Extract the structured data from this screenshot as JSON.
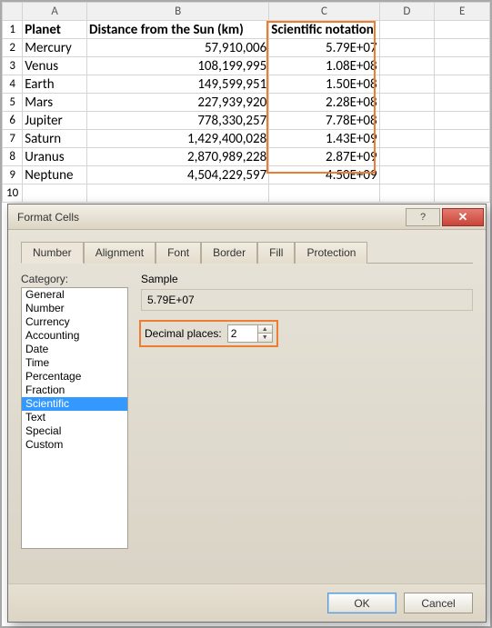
{
  "columns": [
    "",
    "A",
    "B",
    "C",
    "D",
    "E"
  ],
  "rows": [
    {
      "n": "1",
      "a": "Planet",
      "b": "Distance from the Sun (km)",
      "c": "Scientific notation",
      "bold": true
    },
    {
      "n": "2",
      "a": "Mercury",
      "b": "57,910,006",
      "c": "5.79E+07"
    },
    {
      "n": "3",
      "a": "Venus",
      "b": "108,199,995",
      "c": "1.08E+08"
    },
    {
      "n": "4",
      "a": "Earth",
      "b": "149,599,951",
      "c": "1.50E+08"
    },
    {
      "n": "5",
      "a": "Mars",
      "b": "227,939,920",
      "c": "2.28E+08"
    },
    {
      "n": "6",
      "a": "Jupiter",
      "b": "778,330,257",
      "c": "7.78E+08"
    },
    {
      "n": "7",
      "a": "Saturn",
      "b": "1,429,400,028",
      "c": "1.43E+09"
    },
    {
      "n": "8",
      "a": "Uranus",
      "b": "2,870,989,228",
      "c": "2.87E+09"
    },
    {
      "n": "9",
      "a": "Neptune",
      "b": "4,504,229,597",
      "c": "4.50E+09"
    },
    {
      "n": "10",
      "a": "",
      "b": "",
      "c": ""
    }
  ],
  "dialog": {
    "title": "Format Cells",
    "help_glyph": "?",
    "close_glyph": "✕",
    "tabs": [
      "Number",
      "Alignment",
      "Font",
      "Border",
      "Fill",
      "Protection"
    ],
    "active_tab": 0,
    "category_label": "Category:",
    "categories": [
      "General",
      "Number",
      "Currency",
      "Accounting",
      "Date",
      "Time",
      "Percentage",
      "Fraction",
      "Scientific",
      "Text",
      "Special",
      "Custom"
    ],
    "selected_category": "Scientific",
    "sample_label": "Sample",
    "sample_value": "5.79E+07",
    "decimal_label": "Decimal places:",
    "decimal_value": "2",
    "ok_label": "OK",
    "cancel_label": "Cancel"
  },
  "highlight_color": "#ed7d31"
}
